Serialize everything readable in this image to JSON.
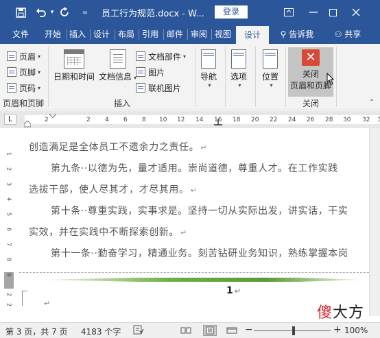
{
  "titlebar": {
    "doc_title": "员工行为规范.docx - W...",
    "login": "登录",
    "icons": [
      "save-icon",
      "undo-icon",
      "redo-icon",
      "customize-icon"
    ]
  },
  "tabs": [
    "文件",
    "开始",
    "插入",
    "设计",
    "布局",
    "引用",
    "邮件",
    "审阅",
    "视图",
    "设计"
  ],
  "tell_me": "告诉我",
  "share": "共享",
  "ribbon": {
    "header_footer": {
      "header": "页眉",
      "footer": "页脚",
      "page_number": "页码",
      "label": "页眉和页脚"
    },
    "insert": {
      "date_time": "日期和时间",
      "doc_info": "文档信息",
      "quick_parts": "文档部件",
      "pictures": "图片",
      "online_pictures": "联机图片",
      "label": "插入"
    },
    "navigation": "导航",
    "options": "选项",
    "position": "位置",
    "close": {
      "line1": "关闭",
      "line2": "页眉和页脚",
      "label": "关闭"
    }
  },
  "ruler": {
    "corner": "L",
    "ticks": [
      "2",
      "2",
      "4",
      "6",
      "8",
      "10",
      "12",
      "14",
      "16",
      "18",
      "20",
      "22",
      "24",
      "26",
      "28",
      "30",
      "32",
      "34"
    ]
  },
  "vruler_ticks": [
    "1",
    "2",
    "3",
    "4",
    "5",
    "6",
    "7",
    "8",
    "9",
    "2",
    "2"
  ],
  "document": {
    "lines": [
      "创造满足是全体员工不遗余力之责任。",
      "第九条··以德为先，量才适用。崇尚道德，尊重人才。在工作实践",
      "选拔干部，使人尽其才，才尽其用。",
      "第十条··尊重实践，实事求是。坚持一切从实际出发，讲实话，干实",
      "实效，并在实践中不断探索创新。",
      "第十一条··勤奋学习，精通业务。刻苦钻研业务知识，熟练掌握本岗"
    ],
    "para_mark": "↵",
    "page_number": "1"
  },
  "watermark": {
    "part1": "傻",
    "part2": "大方"
  },
  "status": {
    "page": "第 3 页，共 7 页",
    "words": "4183 个字",
    "zoom": "100%"
  }
}
